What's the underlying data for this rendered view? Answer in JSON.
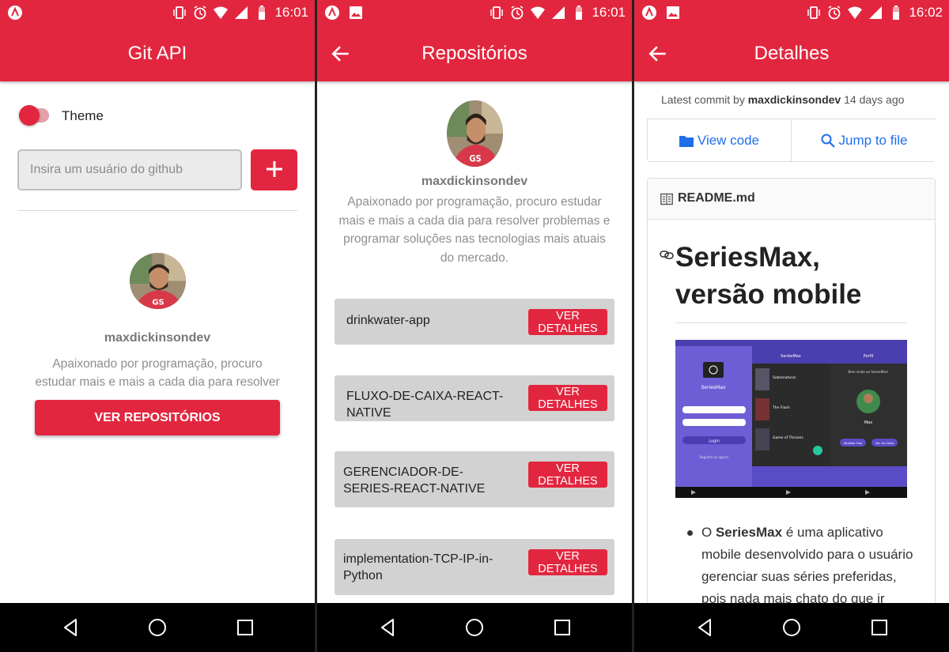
{
  "colors": {
    "primary": "#e3263f",
    "link": "#1f6feb",
    "card": "#d2d2d2"
  },
  "panel1": {
    "status_time": "16:01",
    "title": "Git API",
    "theme_label": "Theme",
    "theme_toggle_on": true,
    "search_placeholder": "Insira um usuário do github",
    "add_icon": "plus-icon",
    "username": "maxdickinsondev",
    "bio": "Apaixonado por programação, procuro estudar mais e mais a cada dia para resolver problema…",
    "repos_button": "VER REPOSITÓRIOS"
  },
  "panel2": {
    "status_time": "16:01",
    "title": "Repositórios",
    "username": "maxdickinsondev",
    "bio": "Apaixonado por programação, procuro estudar mais e mais a cada dia para resolver problemas e programar soluções nas tecnologias mais atuais do mercado.",
    "repos": [
      {
        "name": "drinkwater-app",
        "button": "VER DETALHES"
      },
      {
        "name": "FLUXO-DE-CAIXA-REACT-NATIVE",
        "button": "VER DETALHES"
      },
      {
        "name": "GERENCIADOR-DE-SERIES-REACT-NATIVE",
        "button": "VER DETALHES"
      },
      {
        "name": "implementation-TCP-IP-in-Python",
        "button": "VER DETALHES"
      }
    ]
  },
  "panel3": {
    "status_time": "16:02",
    "title": "Detalhes",
    "commit_prefix": "Latest commit by",
    "commit_author": "maxdickinsondev",
    "commit_age": "14 days ago",
    "view_code": "View code",
    "jump_to_file": "Jump to file",
    "readme_file": "README.md",
    "readme_title": "SeriesMax, versão mobile",
    "bullet_prefix": "O",
    "bullet_bold": "SeriesMax",
    "bullet_rest": "é uma aplicativo mobile desenvolvido para o usuário gerenciar suas séries preferidas, pois nada mais chato do que ir",
    "screenshot": {
      "screen1_title": "SeriesMax",
      "screen1_button": "Login",
      "screen1_link": "Registre-se agora!",
      "screen2_title": "SeriesMax",
      "screen2_items": [
        "Sobrenatural",
        "The Flash",
        "Game of Thrones"
      ],
      "screen3_title": "Perfil",
      "screen3_welcome": "Bem vindo ao SeriesMax!",
      "screen3_user": "Max",
      "screen3_btn1": "Atualizar Foto",
      "screen3_btn2": "Sair da Conta"
    }
  }
}
